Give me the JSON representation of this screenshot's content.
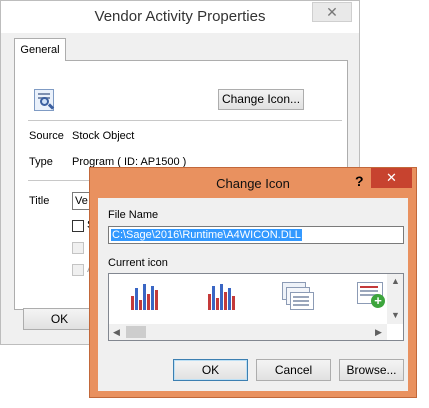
{
  "main_window": {
    "title": "Vendor Activity Properties",
    "close_glyph": "✕",
    "tab": "General",
    "change_icon_button": "Change Icon...",
    "source_label": "Source",
    "source_value": "Stock Object",
    "type_label": "Type",
    "type_value": "Program ( ID: AP1500 )",
    "title_label": "Title",
    "title_value": "Ve",
    "checkbox_letters": [
      "S",
      "",
      "A"
    ],
    "ok_button": "OK"
  },
  "dialog": {
    "title": "Change Icon",
    "help_glyph": "?",
    "close_glyph": "✕",
    "file_name_label": "File Name",
    "file_name_value": "C:\\Sage\\2016\\Runtime\\A4WICON.DLL",
    "current_icon_label": "Current icon",
    "icons": [
      "bar-chart-icon",
      "bar-chart-icon",
      "stacked-forms-icon",
      "form-add-icon"
    ],
    "ok_button": "OK",
    "cancel_button": "Cancel",
    "browse_button": "Browse..."
  },
  "colors": {
    "dialog_frame": "#e9915f",
    "dialog_close": "#c7432f",
    "selection": "#3399ff"
  }
}
